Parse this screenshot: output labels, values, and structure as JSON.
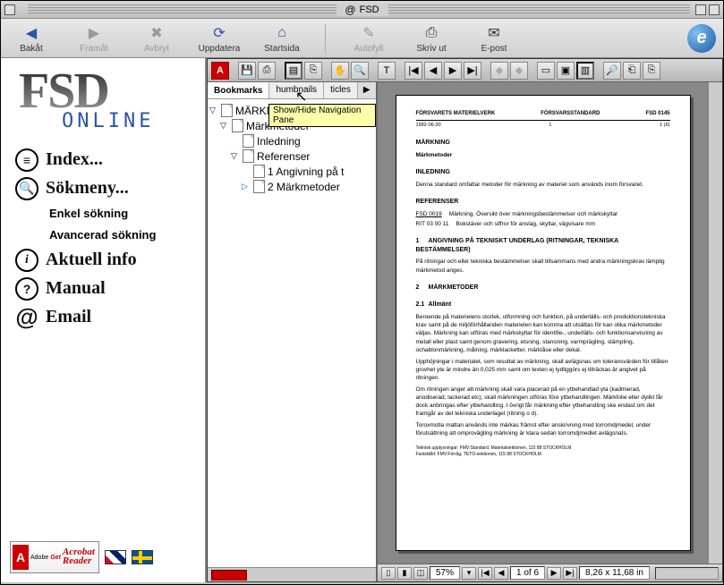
{
  "window": {
    "title": "FSD"
  },
  "browser_toolbar": {
    "back": "Bakåt",
    "forward": "Framåt",
    "stop": "Avbryt",
    "refresh": "Uppdatera",
    "home": "Startsida",
    "autofill": "Autofyll",
    "print": "Skriv ut",
    "mail": "E-post"
  },
  "sidebar": {
    "logo_main": "FSD",
    "logo_sub": "ONLINE",
    "items": [
      {
        "label": "Index..."
      },
      {
        "label": "Sökmeny..."
      },
      {
        "label": "Aktuell info"
      },
      {
        "label": "Manual"
      },
      {
        "label": "Email"
      }
    ],
    "search_sub": {
      "simple": "Enkel sökning",
      "advanced": "Avancerad sökning"
    },
    "acrobat_get": "Get",
    "acrobat_label": "Acrobat\nReader",
    "adobe": "Adobe"
  },
  "acrobat": {
    "tabs": {
      "bookmarks": "Bookmarks",
      "thumbnails": "humbnails",
      "articles": "ticles"
    },
    "tooltip": "Show/Hide Navigation Pane",
    "bookmarks": [
      {
        "label": "MÄRKNIN",
        "level": 0,
        "expanded": true
      },
      {
        "label": "Märkmetoder",
        "level": 1,
        "expanded": true
      },
      {
        "label": "Inledning",
        "level": 2,
        "expanded": false
      },
      {
        "label": "Referenser",
        "level": 2,
        "expanded": true
      },
      {
        "label": "1 Angivning på t",
        "level": 3,
        "expanded": false
      },
      {
        "label": "2 Märkmetoder",
        "level": 3,
        "expanded": true,
        "arrow": true
      }
    ],
    "status": {
      "zoom": "57%",
      "page": "1 of 6",
      "size": "8,26 x 11,68 in"
    }
  },
  "document": {
    "header_left": "FÖRSVARETS MATERIELVERK",
    "header_mid": "FÖRSVARSSTANDARD",
    "header_right": "FSD 0145",
    "header2_left": "1982-06-30",
    "header2_mid": "1",
    "header2_right": "1 (6)",
    "h_title": "MÄRKNING",
    "h_sub": "Märkmetoder",
    "h_inl": "INLEDNING",
    "p_inl": "Denna standard omfattar metoder för märkning av materiel som används inom försvaret.",
    "h_ref": "REFERENSER",
    "ref1_id": "FSD 0019",
    "ref1_txt": "Märkning. Översikt över märkningsbestämmelser och märkskyltar",
    "ref2_id": "RIT 03 00 11",
    "ref2_txt": "Bokstäver och siffror för anslag, skyltar, vägvisare mm",
    "s1_num": "1",
    "s1_title": "ANGIVNING PÅ TEKNISKT UNDERLAG (RITNINGAR, TEKNISKA BESTÄMMELSER)",
    "s1_p": "På ritningar och eller tekniska bestämmelser skall tillsammans med andra märkningskrav lämplig märkmetod anges.",
    "s2_num": "2",
    "s2_title": "MÄRKMETODER",
    "s21_num": "2.1",
    "s21_title": "Allmänt",
    "s21_p1": "Beroende på materielens storlek, utformning och funktion, på underlälls- och produktionstekniska krav samt på de miljöförhållanden materielen kan komma att utsättas för kan olika märkmetoder väljas. Märkning kan utföras med märkskyltar för identifie-, underlälls- och funktionsanvisning av metall eller plast samt genom gravering, etsning, stansning, varmprägling, stämpling, ochablonmärkning, målning, märklacketter, märklåse eller dekal.",
    "s21_p2": "Upphöjningar i materialet, som resultat av märkning, skall avlägsnas om toleransvärden för tillåten grovhet yte är mindre än 0,025 mm samt om texten ej tydliggörs ej tillräckas är angivet på ritningen.",
    "s21_p3": "Om ritningen anger att märkning skall vara placerad på en ytbehandlad yta (kadmierad, anodiserad, lackerad etc), skall märkningen utföras före ytbehandlingen. Märkfolie eller dylikt får dock anbringas efter ytbehandling. I övrigt får märkning efter ytbehandling ske endast om det framgår av det tekniska underlaget (ritning o d).",
    "s21_p4": "Toroxmotla mattan används inte märkas främst efter anskrivning med torromdjmedel, under förutsättning att omprovägling märkning är klara sedan torromdjmedlet avlägsnats.",
    "s21_foot": "Teknisk upplysningar: FMV:Standard, Materialsektionen, 115 88 STOCKHOLM\nFastställd: FMV:Förråg, TETO-sektionen, 115 88 STOCKHOLM"
  }
}
